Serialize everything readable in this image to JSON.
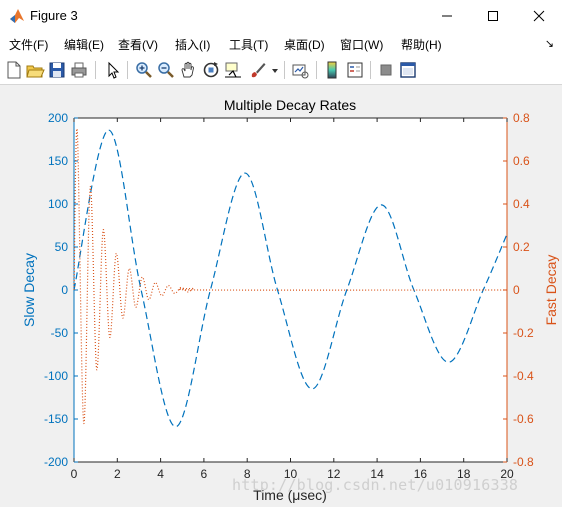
{
  "window": {
    "title": "Figure 3",
    "controls": [
      "minimize",
      "maximize",
      "close"
    ]
  },
  "menu": {
    "items": [
      "文件(F)",
      "编辑(E)",
      "查看(V)",
      "插入(I)",
      "工具(T)",
      "桌面(D)",
      "窗口(W)",
      "帮助(H)"
    ],
    "overflow_glyph": "↘"
  },
  "toolbar": {
    "buttons": [
      "new-figure-icon",
      "open-file-icon",
      "save-icon",
      "print-icon",
      "edit-plot-arrow-icon",
      "zoom-in-icon",
      "zoom-out-icon",
      "pan-hand-icon",
      "rotate-3d-icon",
      "data-cursor-icon",
      "brush-icon",
      "link-plot-icon",
      "insert-colorbar-icon",
      "insert-legend-icon",
      "hide-plot-tools-icon",
      "show-plot-tools-icon"
    ]
  },
  "chart_data": {
    "type": "line",
    "title": "Multiple Decay Rates",
    "xlabel": "Time (μsec)",
    "ylabel_left": "Slow Decay",
    "ylabel_right": "Fast Decay",
    "xlim": [
      0,
      20
    ],
    "ylim_left": [
      -200,
      200
    ],
    "ylim_right": [
      -0.8,
      0.8
    ],
    "xticks": [
      "0",
      "2",
      "4",
      "6",
      "8",
      "10",
      "12",
      "14",
      "16",
      "18",
      "20"
    ],
    "yticks_left": [
      "-200",
      "-150",
      "-100",
      "-50",
      "0",
      "50",
      "100",
      "150",
      "200"
    ],
    "yticks_right": [
      "-0.8",
      "-0.6",
      "-0.4",
      "-0.2",
      "0",
      "0.2",
      "0.4",
      "0.6",
      "0.8"
    ],
    "grid": false,
    "colors": {
      "left": "#0072bd",
      "right": "#d95319"
    },
    "series": [
      {
        "axis": "left",
        "style": "dashed",
        "points": [
          [
            0,
            0
          ],
          [
            1.6,
            186
          ],
          [
            3.1,
            0
          ],
          [
            4.7,
            -159
          ],
          [
            6.3,
            0
          ],
          [
            7.9,
            136
          ],
          [
            9.4,
            0
          ],
          [
            11.0,
            -115
          ],
          [
            12.6,
            0
          ],
          [
            14.2,
            99
          ],
          [
            15.7,
            0
          ],
          [
            17.3,
            -84
          ],
          [
            18.9,
            0
          ],
          [
            20,
            65
          ]
        ]
      },
      {
        "axis": "right",
        "style": "dotted",
        "points": [
          [
            0,
            0
          ],
          [
            0.15,
            0.74
          ],
          [
            0.45,
            -0.62
          ],
          [
            0.75,
            0.48
          ],
          [
            1.05,
            -0.37
          ],
          [
            1.35,
            0.28
          ],
          [
            1.65,
            -0.22
          ],
          [
            1.95,
            0.17
          ],
          [
            2.25,
            -0.13
          ],
          [
            2.55,
            0.1
          ],
          [
            2.85,
            -0.08
          ],
          [
            3.15,
            0.06
          ],
          [
            3.45,
            -0.045
          ],
          [
            3.75,
            0.035
          ],
          [
            4.05,
            -0.027
          ],
          [
            4.35,
            0.021
          ],
          [
            4.65,
            -0.016
          ],
          [
            4.95,
            0.012
          ],
          [
            5.25,
            -0.009
          ],
          [
            5.55,
            0.007
          ],
          [
            6.0,
            0
          ],
          [
            20,
            0
          ]
        ]
      }
    ]
  },
  "watermark": "http://blog.csdn.net/u010916338"
}
